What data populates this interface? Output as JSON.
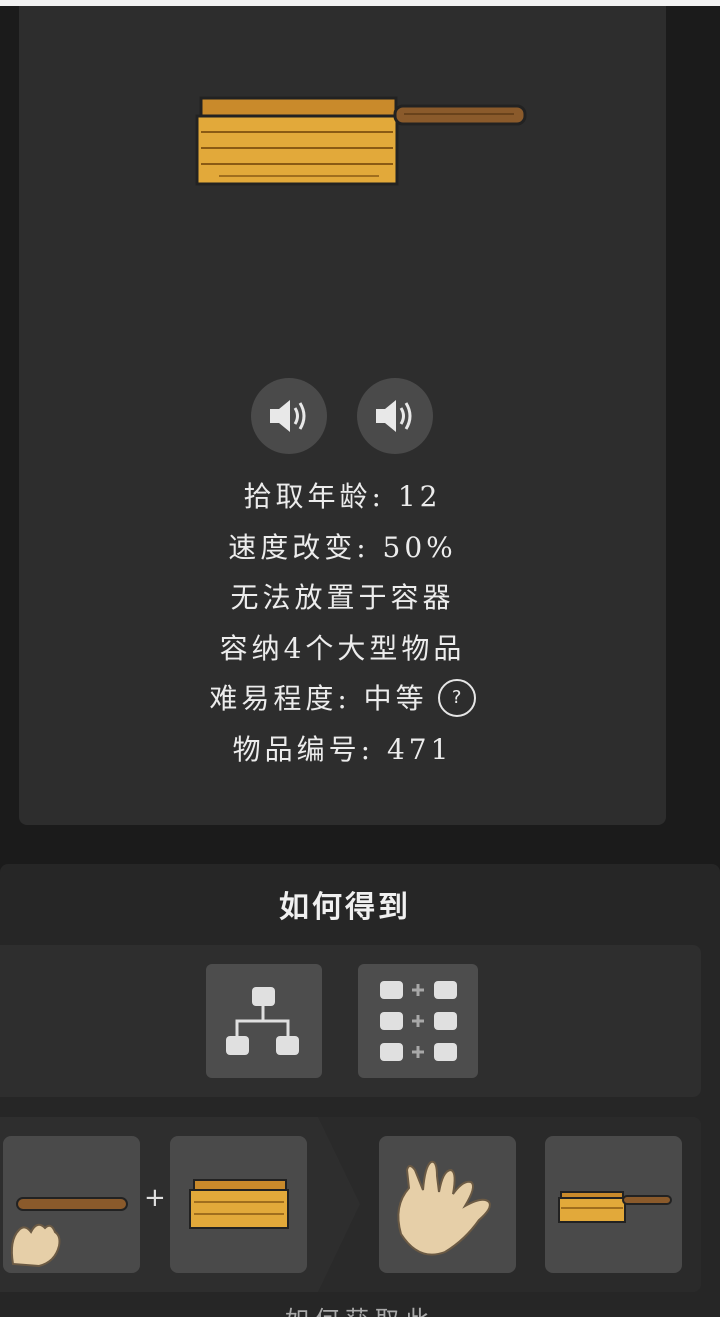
{
  "item": {
    "image_icon": "wooden-pan-with-handle",
    "sound_buttons": [
      "speaker-icon",
      "speaker-icon"
    ],
    "properties": [
      "拾取年龄: 12",
      "速度改变: 50%",
      "无法放置于容器",
      "容纳4个大型物品",
      "难易程度: 中等"
    ],
    "help_symbol": "?",
    "item_number": "物品编号: 471"
  },
  "how_to_get": {
    "title": "如何得到",
    "tool_buttons": [
      "tech-tree-icon",
      "recipe-grid-icon"
    ],
    "recipe": {
      "ingredients": [
        "long-stick-in-hand",
        "wooden-box"
      ],
      "plus": "+",
      "actor": "empty-hand",
      "result": "wooden-pan-with-handle"
    }
  },
  "bottom_hint": "如何获取此"
}
